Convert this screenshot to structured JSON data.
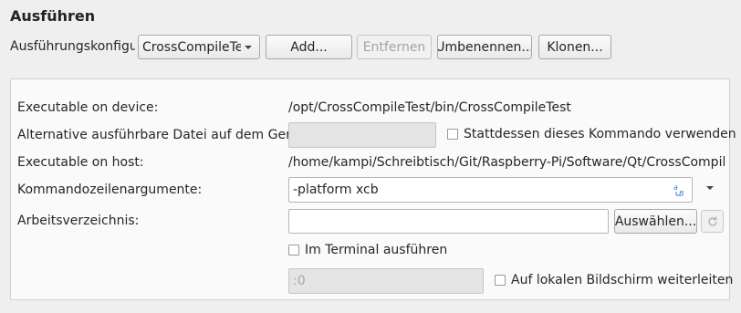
{
  "section_title": "Ausführen",
  "config": {
    "label": "Ausführungskonfigur",
    "selected": "CrossCompileTe",
    "add_label": "Add...",
    "remove_label": "Entfernen",
    "rename_label": "Umbenennen...",
    "clone_label": "Klonen..."
  },
  "panel": {
    "exec_device_label": "Executable on device:",
    "exec_device_value": "/opt/CrossCompileTest/bin/CrossCompileTest",
    "alt_exec_label": "Alternative ausführbare Datei auf dem Gerät:",
    "alt_exec_value": "",
    "use_command_label": "Stattdessen dieses Kommando verwenden",
    "exec_host_label": "Executable on host:",
    "exec_host_value": "/home/kampi/Schreibtisch/Git/Raspberry-Pi/Software/Qt/CrossCompileTe",
    "args_label": "Kommandozeilenargumente:",
    "args_value": "-platform xcb",
    "workdir_label": "Arbeitsverzeichnis:",
    "workdir_value": "",
    "browse_label": "Auswählen...",
    "terminal_label": "Im Terminal ausführen",
    "display_value": ":0",
    "local_display_label": "Auf lokalen Bildschirm weiterleiten"
  },
  "icons": {
    "clear": "clear-text-icon",
    "reset": "reset-icon",
    "dropdown": "chevron-down-icon"
  },
  "colors": {
    "accent": "#3a7bd5",
    "panel_bg": "#fafafa",
    "window_bg": "#efefef"
  }
}
